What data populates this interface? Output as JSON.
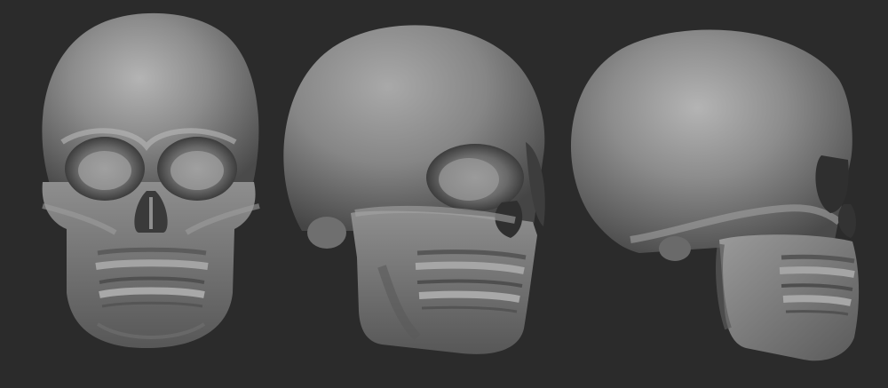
{
  "scene": {
    "background_color": "#2b2b2b",
    "material_color": "#8a8a8a",
    "views": [
      {
        "name": "skull-front-view",
        "angle": "front"
      },
      {
        "name": "skull-three-quarter-view",
        "angle": "three-quarter"
      },
      {
        "name": "skull-side-view",
        "angle": "side"
      }
    ]
  }
}
